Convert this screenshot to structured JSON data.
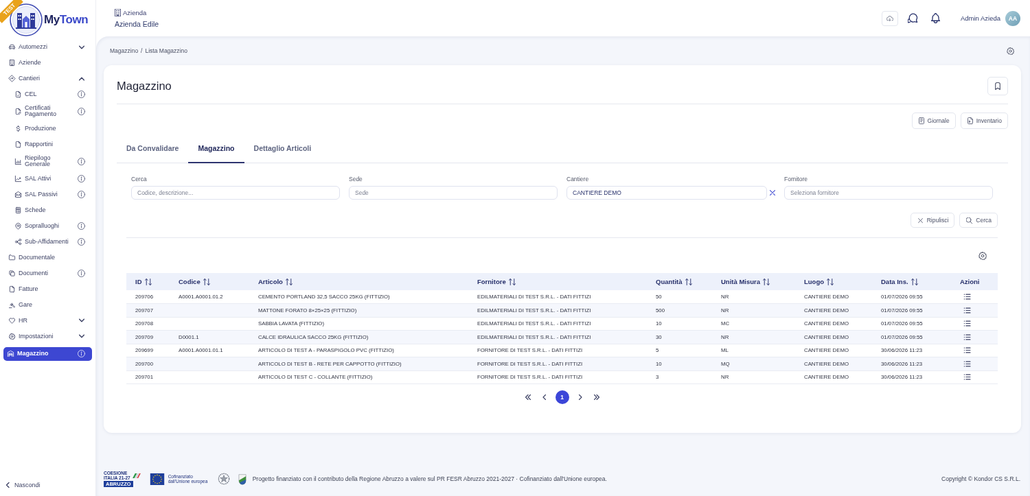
{
  "badge": {
    "label": "TEST"
  },
  "brand": {
    "parts": [
      "My",
      "Town"
    ]
  },
  "sidebar": {
    "items": [
      {
        "label": "Automezzi",
        "expanded": false,
        "info": false,
        "selected": false
      },
      {
        "label": "Aziende",
        "info": false,
        "selected": false
      },
      {
        "label": "Cantieri",
        "expanded": true,
        "info": false,
        "selected": false,
        "children": [
          {
            "label": "CEL",
            "info": true,
            "selected": false
          },
          {
            "label": "Certificati Pagamento",
            "info": true,
            "selected": false
          },
          {
            "label": "Produzione",
            "info": false,
            "selected": false
          },
          {
            "label": "Rapportini",
            "info": false,
            "selected": false
          },
          {
            "label": "Riepilogo Generale",
            "info": true,
            "selected": false
          },
          {
            "label": "SAL Attivi",
            "info": true,
            "selected": false
          },
          {
            "label": "SAL Passivi",
            "info": true,
            "selected": false
          },
          {
            "label": "Schede",
            "info": false,
            "selected": false
          },
          {
            "label": "Sopralluoghi",
            "info": true,
            "selected": false
          },
          {
            "label": "Sub-Affidamenti",
            "info": true,
            "selected": false
          }
        ]
      },
      {
        "label": "Documentale",
        "info": false,
        "selected": false
      },
      {
        "label": "Documenti",
        "info": true,
        "selected": false
      },
      {
        "label": "Fatture",
        "info": false,
        "selected": false
      },
      {
        "label": "Gare",
        "info": false,
        "selected": false
      },
      {
        "label": "HR",
        "expanded": false,
        "info": false,
        "selected": false
      },
      {
        "label": "Impostazioni",
        "expanded": false,
        "info": false,
        "selected": false
      },
      {
        "label": "Magazzino",
        "info": true,
        "selected": true
      }
    ],
    "hide_label": "Nascondi"
  },
  "header": {
    "company_label": "Azienda",
    "company_name": "Azienda Edile",
    "user_name": "Admin Azieda",
    "avatar_initials": "AA"
  },
  "breadcrumb": {
    "items": [
      "Magazzino",
      "Lista Magazzino"
    ],
    "separator": "/"
  },
  "page": {
    "title": "Magazzino",
    "actions": [
      "Giornale",
      "Inventario"
    ]
  },
  "tabs": [
    {
      "label": "Da Convalidare",
      "selected": false
    },
    {
      "label": "Magazzino",
      "selected": true
    },
    {
      "label": "Dettaglio Articoli",
      "selected": false
    }
  ],
  "filters": [
    {
      "label": "Cerca",
      "placeholder": "Codice, descrizione...",
      "clearable": false
    },
    {
      "label": "Sede",
      "placeholder": "Sede",
      "clearable": false
    },
    {
      "label": "Cantiere",
      "value": "CANTIERE DEMO",
      "clearable": true
    },
    {
      "label": "Fornitore",
      "placeholder": "Seleziona fornitore",
      "clearable": false
    }
  ],
  "filter_buttons": [
    "Ripulisci",
    "Cerca"
  ],
  "table": {
    "columns": [
      {
        "label": "ID",
        "kind": "text",
        "sortable": true
      },
      {
        "label": "Codice",
        "kind": "text",
        "sortable": true
      },
      {
        "label": "Articolo",
        "kind": "text",
        "sortable": true
      },
      {
        "label": "Fornitore",
        "kind": "text",
        "sortable": true
      },
      {
        "label": "Quantità",
        "kind": "text",
        "sortable": true
      },
      {
        "label": "Unità Misura",
        "kind": "text",
        "sortable": true
      },
      {
        "label": "Luogo",
        "kind": "text",
        "sortable": true
      },
      {
        "label": "Data Ins.",
        "kind": "text",
        "sortable": true
      },
      {
        "label": "Azioni",
        "kind": "actions",
        "sortable": false
      }
    ],
    "rows": [
      {
        "id": "209706",
        "codice": "A0001.A0001.01.2",
        "articolo": "CEMENTO PORTLAND 32,5 SACCO 25KG (FITTIZIO)",
        "fornitore": "EDILMATERIALI DI TEST S.R.L. - DATI FITTIZI",
        "quantita": "50",
        "unita_misura": "NR",
        "luogo": "CANTIERE DEMO",
        "data_ins": "01/07/2026 09:55"
      },
      {
        "id": "209707",
        "articolo": "MATTONE FORATO 8×25×25 (FITTIZIO)",
        "fornitore": "EDILMATERIALI DI TEST S.R.L. - DATI FITTIZI",
        "quantita": "500",
        "unita_misura": "NR",
        "luogo": "CANTIERE DEMO",
        "data_ins": "01/07/2026 09:55"
      },
      {
        "id": "209708",
        "articolo": "SABBIA LAVATA (FITTIZIO)",
        "fornitore": "EDILMATERIALI DI TEST S.R.L. - DATI FITTIZI",
        "quantita": "10",
        "unita_misura": "MC",
        "luogo": "CANTIERE DEMO",
        "data_ins": "01/07/2026 09:55"
      },
      {
        "id": "209709",
        "codice": "D0001.1",
        "articolo": "CALCE IDRAULICA SACCO 25KG (FITTIZIO)",
        "fornitore": "EDILMATERIALI DI TEST S.R.L. - DATI FITTIZI",
        "quantita": "30",
        "unita_misura": "NR",
        "luogo": "CANTIERE DEMO",
        "data_ins": "01/07/2026 09:55"
      },
      {
        "id": "209699",
        "codice": "A0001.A0001.01.1",
        "articolo": "ARTICOLO DI TEST A - PARASPIGOLO PVC (FITTIZIO)",
        "fornitore": "FORNITORE DI TEST S.R.L. - DATI FITTIZI",
        "quantita": "5",
        "unita_misura": "ML",
        "luogo": "CANTIERE DEMO",
        "data_ins": "30/06/2026 11:23"
      },
      {
        "id": "209700",
        "articolo": "ARTICOLO DI TEST B - RETE PER CAPPOTTO (FITTIZIO)",
        "fornitore": "FORNITORE DI TEST S.R.L. - DATI FITTIZI",
        "quantita": "10",
        "unita_misura": "MQ",
        "luogo": "CANTIERE DEMO",
        "data_ins": "30/06/2026 11:23"
      },
      {
        "id": "209701",
        "articolo": "ARTICOLO DI TEST C - COLLANTE (FITTIZIO)",
        "fornitore": "FORNITORE DI TEST S.R.L. - DATI FITTIZI",
        "quantita": "3",
        "unita_misura": "NR",
        "luogo": "CANTIERE DEMO",
        "data_ins": "30/06/2026 11:23"
      }
    ]
  },
  "pagination": {
    "pages": [
      {
        "label": "1",
        "selected": true
      }
    ]
  },
  "footer": {
    "cohesion_logo": {
      "lines": [
        "COESIONE",
        "ITALIA 21-27"
      ],
      "band": "ABRUZZO"
    },
    "eu_logo": {
      "caption": "Cofinanziato dall'Unione europea"
    },
    "funding_text": "Progetto finanziato con il contributo della Regione Abruzzo a valere sul PR FESR Abruzzo 2021-2027 · Cofinanziato dall'Unione europea.",
    "copyright": "Copyright © Kondor CS S.R.L."
  }
}
